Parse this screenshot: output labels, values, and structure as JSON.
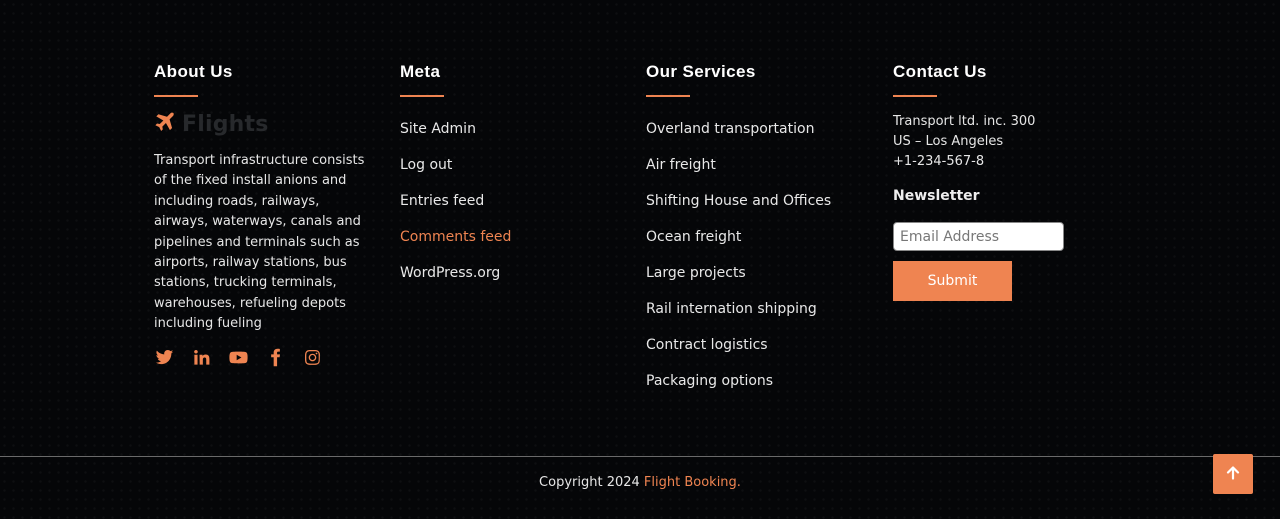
{
  "about": {
    "heading": "About Us",
    "logo_text": "Flights",
    "logo_icon": "plane-icon",
    "description": "Transport infrastructure consists of the fixed install anions and including roads, railways, airways, waterways, canals and pipelines and terminals such as airports, railway stations, bus stations, trucking terminals, warehouses, refueling depots including fueling",
    "socials": [
      "twitter-icon",
      "linkedin-icon",
      "youtube-icon",
      "facebook-icon",
      "instagram-icon"
    ]
  },
  "meta": {
    "heading": "Meta",
    "links": [
      {
        "label": "Site Admin"
      },
      {
        "label": "Log out"
      },
      {
        "label": "Entries feed"
      },
      {
        "label": "Comments feed"
      },
      {
        "label": "WordPress.org"
      }
    ]
  },
  "services": {
    "heading": "Our Services",
    "links": [
      {
        "label": "Overland transportation"
      },
      {
        "label": "Air freight"
      },
      {
        "label": "Shifting House and Offices"
      },
      {
        "label": "Ocean freight"
      },
      {
        "label": "Large projects"
      },
      {
        "label": "Rail internation shipping"
      },
      {
        "label": "Contract logistics"
      },
      {
        "label": "Packaging options"
      }
    ]
  },
  "contact": {
    "heading": "Contact Us",
    "address_line1": "Transport ltd. inc. 300",
    "address_line2": "US – Los Angeles",
    "phone": "+1-234-567-8",
    "newsletter_title": "Newsletter",
    "email_placeholder": "Email Address",
    "email_value": "",
    "submit_label": "Submit"
  },
  "copyright": {
    "prefix": "Copyright 2024 ",
    "brand": "Flight Booking."
  },
  "scroll_top_icon": "arrow-up-icon",
  "colors": {
    "accent": "#ef8451",
    "background": "#050608",
    "divider": "#6a6a6a"
  }
}
